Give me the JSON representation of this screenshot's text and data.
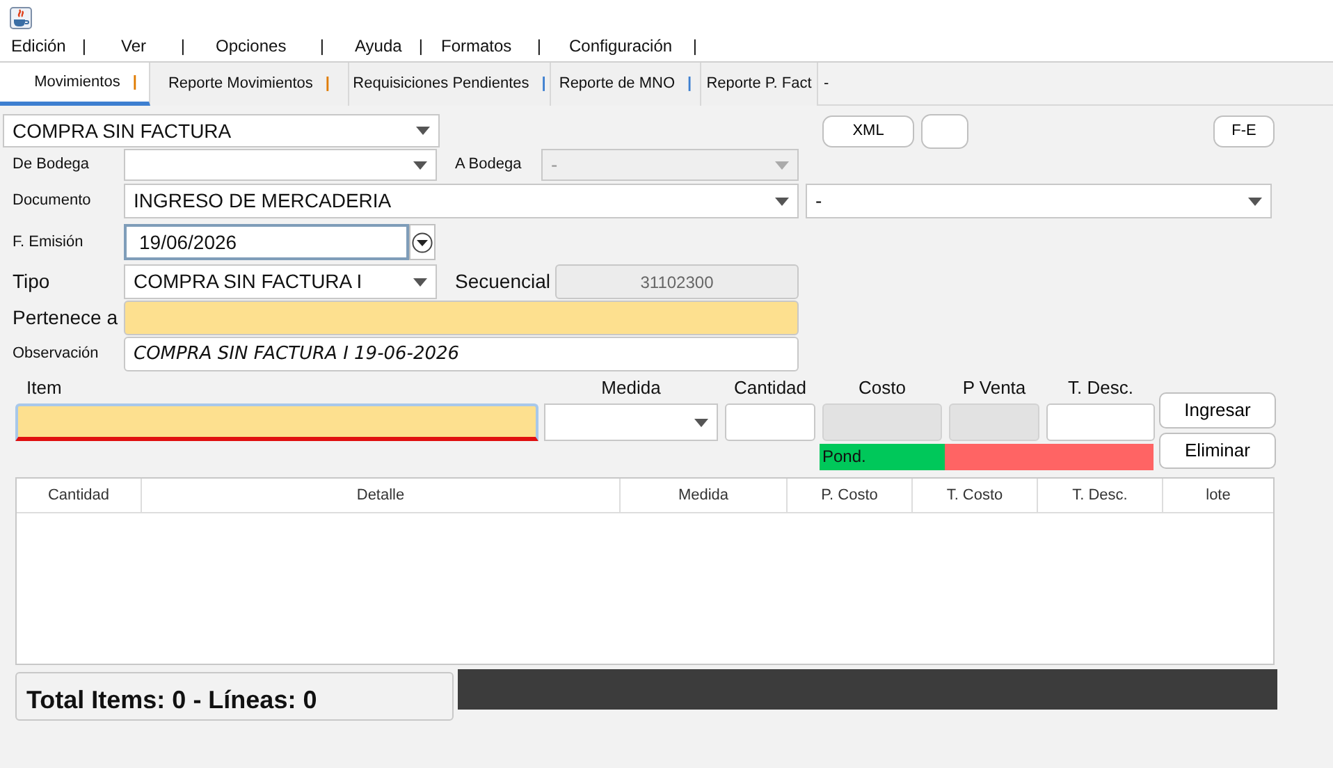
{
  "menu": [
    {
      "label": "Edición",
      "separator": "|"
    },
    {
      "label": "Ver",
      "separator": "|"
    },
    {
      "label": "Opciones",
      "separator": "|"
    },
    {
      "label": "Ayuda",
      "separator": "|"
    },
    {
      "label": "Formatos",
      "separator": "|"
    },
    {
      "label": "Configuración",
      "separator": "|"
    }
  ],
  "tabs": [
    {
      "label": "Movimientos",
      "selected": true,
      "separator": "|",
      "color": "#e07b00"
    },
    {
      "label": "Reporte Movimientos",
      "selected": false,
      "separator": "|",
      "color": "#e07b00"
    },
    {
      "label": "Requisiciones Pendientes",
      "selected": false,
      "separator": "|",
      "color": "#3d7fd0"
    },
    {
      "label": "Reporte de MNO",
      "selected": false,
      "separator": "|",
      "color": "#3d7fd0"
    },
    {
      "label": "Reporte P. Fact",
      "selected": false
    }
  ],
  "tabs_trailing": "-",
  "mode": {
    "value": "COMPRA SIN FACTURA"
  },
  "top_buttons": [
    {
      "kind": "text",
      "label": "XML"
    },
    {
      "kind": "blank"
    },
    {
      "kind": "text",
      "label": "F-E"
    }
  ],
  "de_bodega": {
    "label": "De Bodega"
  },
  "a_bodega": {
    "label": "A Bodega",
    "value": "-",
    "disabled": true
  },
  "documento": {
    "label": "Documento",
    "value": "INGRESO DE MERCADERIA",
    "value_2": "-"
  },
  "f_emision": {
    "label": "F. Emisión",
    "value": "19/06/2026"
  },
  "tipo": {
    "label": "Tipo",
    "value": "COMPRA SIN FACTURA I"
  },
  "secuencial": {
    "label": "Secuencial",
    "value": "31102300",
    "disabled": true
  },
  "pertenece_a": {
    "label": "Pertenece a",
    "highlighted": true
  },
  "observacion": {
    "label": "Observación",
    "value": "COMPRA SIN FACTURA I 19-06-2026"
  },
  "item_entry": {
    "fields": [
      {
        "label": "Item",
        "kind": "text",
        "highlighted": true,
        "disabled": false
      },
      {
        "label": "Medida",
        "kind": "combo",
        "highlighted": false,
        "disabled": false
      },
      {
        "label": "Cantidad",
        "kind": "text",
        "highlighted": false,
        "disabled": false
      },
      {
        "label": "Costo",
        "kind": "text",
        "highlighted": false,
        "disabled": true
      },
      {
        "label": "P Venta",
        "kind": "text",
        "highlighted": false,
        "disabled": true
      },
      {
        "label": "T. Desc.",
        "kind": "text",
        "highlighted": false,
        "disabled": false
      }
    ],
    "pond": "Pond.",
    "buttons": [
      "Ingresar",
      "Eliminar"
    ]
  },
  "table": {
    "columns": [
      "Cantidad",
      "Detalle",
      "Medida",
      "P. Costo",
      "T. Costo",
      "T. Desc.",
      "lote"
    ]
  },
  "footer": {
    "totals": "Total Items: 0 - Líneas: 0"
  }
}
